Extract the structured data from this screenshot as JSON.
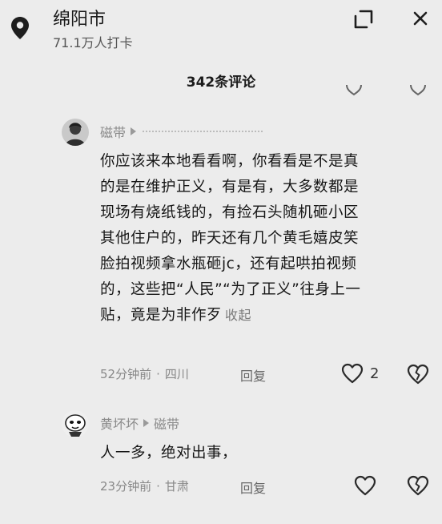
{
  "header": {
    "location_name": "绵阳市",
    "checkins": "71.1万人打卡"
  },
  "comments_header": {
    "count_label": "342条评论"
  },
  "comments": [
    {
      "author": "磁带",
      "body_lines": [
        "你应该来本地看看啊，你看看是不是真",
        "的是在维护正义，有是有，大多数都是",
        "现场有烧纸钱的，有捡石头随机砸小区",
        "其他住户的，昨天还有几个黄毛嬉皮笑",
        "脸拍视频拿水瓶砸jc，还有起哄拍视频",
        "的，这些把“人民”“为了正义”往身上一",
        "贴，竟是为非作歹"
      ],
      "collapse_label": "收起",
      "time": "52分钟前",
      "region": "四川",
      "reply_label": "回复",
      "likes": "2"
    },
    {
      "author": "黄坏坏",
      "reply_to": "磁带",
      "body": "人一多，绝对出事，",
      "time": "23分钟前",
      "region": "甘肃",
      "reply_label": "回复"
    }
  ],
  "icons": {
    "location": "location-pin-icon",
    "expand": "expand-icon",
    "close": "close-icon",
    "like": "heart-icon",
    "dislike": "broken-heart-icon"
  }
}
